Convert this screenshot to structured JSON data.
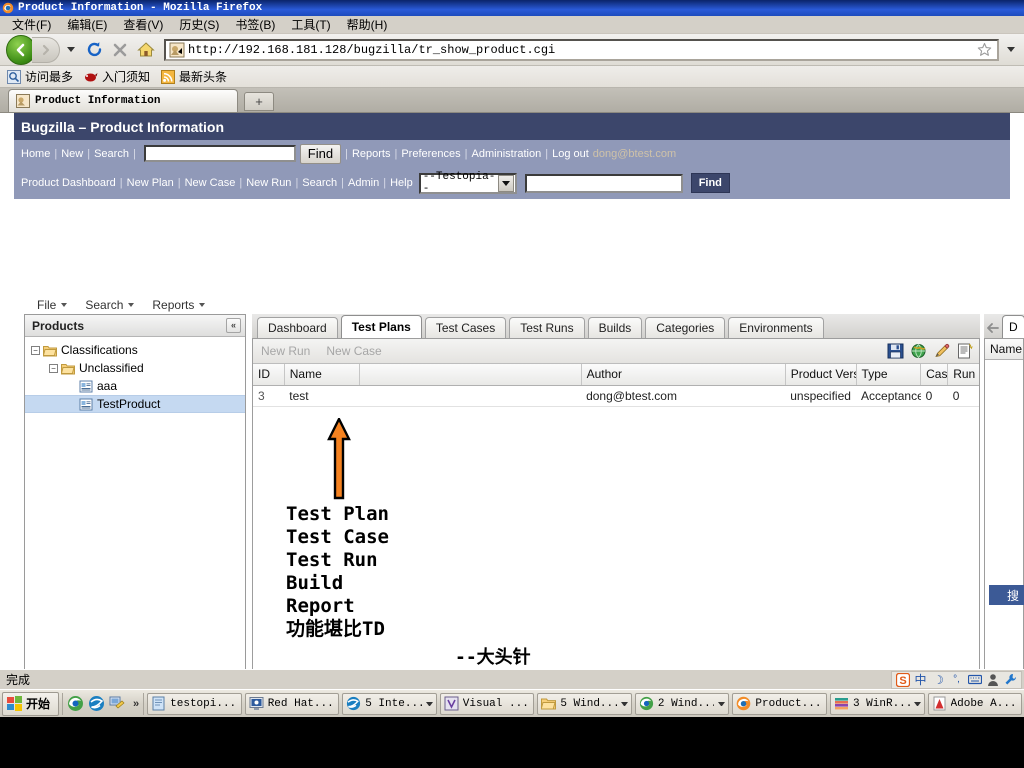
{
  "window": {
    "title": "Product Information - Mozilla Firefox",
    "icon": "firefox-icon"
  },
  "menubar": [
    {
      "label": "文件(F)",
      "name": "menu-file"
    },
    {
      "label": "编辑(E)",
      "name": "menu-edit"
    },
    {
      "label": "查看(V)",
      "name": "menu-view"
    },
    {
      "label": "历史(S)",
      "name": "menu-history"
    },
    {
      "label": "书签(B)",
      "name": "menu-bookmarks"
    },
    {
      "label": "工具(T)",
      "name": "menu-tools"
    },
    {
      "label": "帮助(H)",
      "name": "menu-help"
    }
  ],
  "toolbar": {
    "url": "http://192.168.181.128/bugzilla/tr_show_product.cgi",
    "back_icon": "back-arrow-icon",
    "forward_icon": "forward-arrow-icon",
    "reload_icon": "reload-icon",
    "stop_icon": "stop-icon",
    "home_icon": "home-icon",
    "star_icon": "star-bookmark-icon"
  },
  "bookmarks_bar": [
    {
      "label": "访问最多",
      "icon": "most-visited-icon",
      "name": "bookmark-most-visited"
    },
    {
      "label": "入门须知",
      "icon": "getting-started-icon",
      "name": "bookmark-getting-started"
    },
    {
      "label": "最新头条",
      "icon": "rss-feed-icon",
      "name": "bookmark-latest-headlines"
    }
  ],
  "browser_tabs": {
    "active_tab": "Product Information",
    "new_tab_label": "+"
  },
  "bugzilla": {
    "header_title": "Bugzilla – Product Information",
    "header_bg": "#3c466b",
    "nav_bg": "#9099b8",
    "nav_row1": {
      "links": [
        "Home",
        "New",
        "Search"
      ],
      "search_value": "",
      "find_label": "Find",
      "post_links": [
        "Reports",
        "Preferences",
        "Administration"
      ],
      "logout_label": "Log out",
      "user_email": "dong@btest.com"
    },
    "nav_row2": {
      "links": [
        "Product Dashboard",
        "New Plan",
        "New Case",
        "New Run",
        "Search",
        "Admin",
        "Help"
      ],
      "select_value": "--Testopia--",
      "search_value": "",
      "find_label": "Find"
    }
  },
  "app_menu": [
    {
      "label": "File",
      "name": "app-menu-file"
    },
    {
      "label": "Search",
      "name": "app-menu-search"
    },
    {
      "label": "Reports",
      "name": "app-menu-reports"
    }
  ],
  "products_panel": {
    "title": "Products",
    "collapse_icon": "collapse-left-icon",
    "tree": [
      {
        "label": "Classifications",
        "level": 0,
        "icon": "folder-icon",
        "expanded": true,
        "selected": false
      },
      {
        "label": "Unclassified",
        "level": 1,
        "icon": "folder-icon",
        "expanded": true,
        "selected": false
      },
      {
        "label": "aaa",
        "level": 2,
        "icon": "product-icon",
        "expanded": null,
        "selected": false
      },
      {
        "label": "TestProduct",
        "level": 2,
        "icon": "product-icon",
        "expanded": null,
        "selected": true
      }
    ]
  },
  "center_tabs": [
    {
      "label": "Dashboard",
      "active": false,
      "name": "tab-dashboard"
    },
    {
      "label": "Test Plans",
      "active": true,
      "name": "tab-test-plans"
    },
    {
      "label": "Test Cases",
      "active": false,
      "name": "tab-test-cases"
    },
    {
      "label": "Test Runs",
      "active": false,
      "name": "tab-test-runs"
    },
    {
      "label": "Builds",
      "active": false,
      "name": "tab-builds"
    },
    {
      "label": "Categories",
      "active": false,
      "name": "tab-categories"
    },
    {
      "label": "Environments",
      "active": false,
      "name": "tab-environments"
    }
  ],
  "grid_toolbar": {
    "actions": [
      "New Run",
      "New Case"
    ],
    "icons": [
      {
        "name": "save-floppy-icon"
      },
      {
        "name": "globe-icon"
      },
      {
        "name": "pencil-edit-icon"
      },
      {
        "name": "new-document-icon"
      }
    ]
  },
  "grid": {
    "columns": [
      "ID",
      "Name",
      "",
      "Author",
      "Product Versic",
      "Type",
      "Cas",
      "Run"
    ],
    "rows": [
      {
        "id": "3",
        "name": "test",
        "blank": "",
        "author": "dong@btest.com",
        "product_version": "unspecified",
        "type": "Acceptance",
        "cases": "0",
        "runs": "0"
      }
    ]
  },
  "right_panel": {
    "back_icon": "back-arrow-small-icon",
    "tab_label": "D",
    "column_header": "Name",
    "button_label": "搜"
  },
  "annotation": {
    "arrow_color": "#f58220",
    "lines": [
      "Test Plan",
      "Test Case",
      "Test Run",
      "Build",
      "Report",
      "功能堪比TD"
    ],
    "signature": "--大头针"
  },
  "statusbar": {
    "text": "完成",
    "tray": [
      {
        "name": "sogou-ime-icon",
        "glyph": "S"
      },
      {
        "name": "ime-chinese-icon",
        "glyph": "中"
      },
      {
        "name": "ime-moon-icon",
        "glyph": "☽"
      },
      {
        "name": "ime-punctuation-icon",
        "glyph": "°,"
      },
      {
        "name": "ime-keyboard-icon",
        "glyph": "⌨"
      },
      {
        "name": "ime-user-icon",
        "glyph": "👤"
      },
      {
        "name": "ime-wrench-icon",
        "glyph": "🔧"
      }
    ]
  },
  "taskbar": {
    "start_label": "开始",
    "quick_launch": [
      {
        "name": "ql-firefox-icon"
      },
      {
        "name": "ql-ie-icon"
      },
      {
        "name": "ql-show-desktop-icon"
      }
    ],
    "overflow_label": "»",
    "items": [
      {
        "label": "testopi...",
        "icon": "notepad-icon",
        "caret": false,
        "name": "taskbar-item-testopi"
      },
      {
        "label": "Red Hat...",
        "icon": "vmware-icon",
        "caret": false,
        "name": "taskbar-item-redhat"
      },
      {
        "label": "5 Inte...",
        "icon": "ie-icon",
        "caret": true,
        "name": "taskbar-item-internet-explorer"
      },
      {
        "label": "Visual ...",
        "icon": "visualstudio-icon",
        "caret": false,
        "name": "taskbar-item-visual"
      },
      {
        "label": "5 Wind...",
        "icon": "folder-icon",
        "caret": true,
        "name": "taskbar-item-windows-explorer"
      },
      {
        "label": "2 Wind...",
        "icon": "firefox-globe-icon",
        "caret": true,
        "name": "taskbar-item-windows-2"
      },
      {
        "label": "Product...",
        "icon": "firefox-icon",
        "caret": false,
        "name": "taskbar-item-product"
      },
      {
        "label": "3 WinR...",
        "icon": "winrar-icon",
        "caret": true,
        "name": "taskbar-item-winrar"
      },
      {
        "label": "Adobe A...",
        "icon": "adobe-acrobat-icon",
        "caret": false,
        "name": "taskbar-item-adobe"
      }
    ]
  }
}
